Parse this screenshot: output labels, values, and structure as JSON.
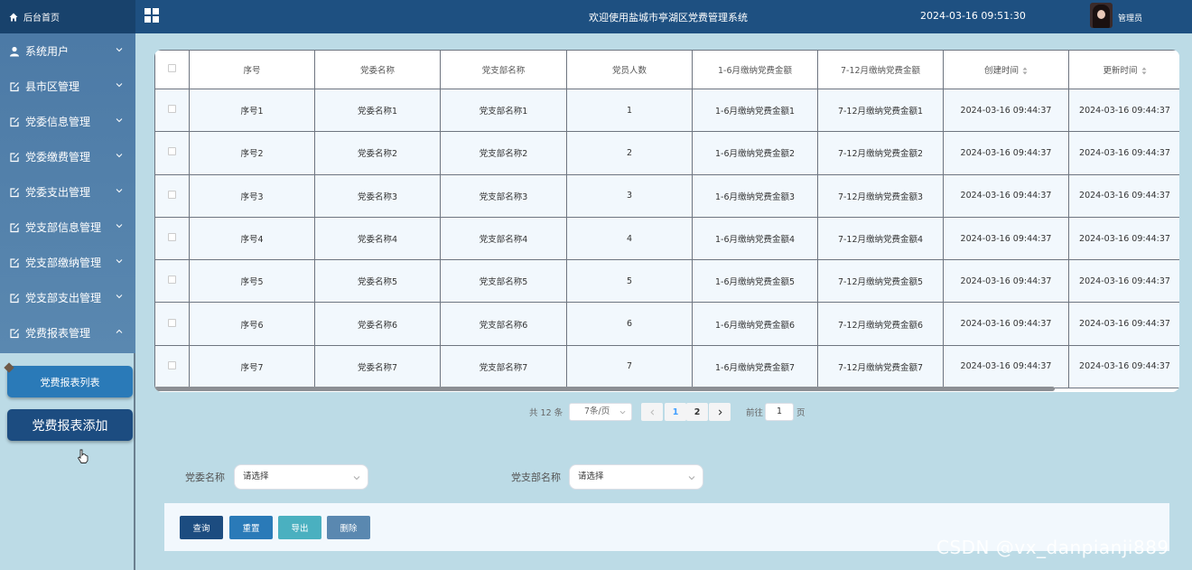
{
  "header": {
    "home_label": "后台首页",
    "welcome": "欢迎使用盐城市亭湖区党费管理系统",
    "datetime": "2024-03-16 09:51:30",
    "user_label": "管理员"
  },
  "sidebar": {
    "items": [
      {
        "label": "系统用户"
      },
      {
        "label": "县市区管理"
      },
      {
        "label": "党委信息管理"
      },
      {
        "label": "党委缴费管理"
      },
      {
        "label": "党委支出管理"
      },
      {
        "label": "党支部信息管理"
      },
      {
        "label": "党支部缴纳管理"
      },
      {
        "label": "党支部支出管理"
      },
      {
        "label": "党费报表管理"
      }
    ],
    "sub_items": [
      {
        "label": "党费报表列表"
      },
      {
        "label": "党费报表添加"
      }
    ]
  },
  "table": {
    "columns": [
      "序号",
      "党委名称",
      "党支部名称",
      "党员人数",
      "1-6月缴纳党费金额",
      "7-12月缴纳党费金额",
      "创建时间",
      "更新时间"
    ],
    "rows": [
      [
        "序号1",
        "党委名称1",
        "党支部名称1",
        "1",
        "1-6月缴纳党费金额1",
        "7-12月缴纳党费金额1",
        "2024-03-16 09:44:37",
        "2024-03-16 09:44:37"
      ],
      [
        "序号2",
        "党委名称2",
        "党支部名称2",
        "2",
        "1-6月缴纳党费金额2",
        "7-12月缴纳党费金额2",
        "2024-03-16 09:44:37",
        "2024-03-16 09:44:37"
      ],
      [
        "序号3",
        "党委名称3",
        "党支部名称3",
        "3",
        "1-6月缴纳党费金额3",
        "7-12月缴纳党费金额3",
        "2024-03-16 09:44:37",
        "2024-03-16 09:44:37"
      ],
      [
        "序号4",
        "党委名称4",
        "党支部名称4",
        "4",
        "1-6月缴纳党费金额4",
        "7-12月缴纳党费金额4",
        "2024-03-16 09:44:37",
        "2024-03-16 09:44:37"
      ],
      [
        "序号5",
        "党委名称5",
        "党支部名称5",
        "5",
        "1-6月缴纳党费金额5",
        "7-12月缴纳党费金额5",
        "2024-03-16 09:44:37",
        "2024-03-16 09:44:37"
      ],
      [
        "序号6",
        "党委名称6",
        "党支部名称6",
        "6",
        "1-6月缴纳党费金额6",
        "7-12月缴纳党费金额6",
        "2024-03-16 09:44:37",
        "2024-03-16 09:44:37"
      ],
      [
        "序号7",
        "党委名称7",
        "党支部名称7",
        "7",
        "1-6月缴纳党费金额7",
        "7-12月缴纳党费金额7",
        "2024-03-16 09:44:37",
        "2024-03-16 09:44:37"
      ]
    ]
  },
  "pagination": {
    "total": "共 12 条",
    "page_size": "7条/页",
    "pages": [
      "1",
      "2"
    ],
    "current_page": "1",
    "goto_label": "前往",
    "goto_value": "1",
    "page_suffix": "页"
  },
  "filters": {
    "party_committee_label": "党委名称",
    "party_committee_value": "请选择",
    "party_branch_label": "党支部名称",
    "party_branch_value": "请选择"
  },
  "actions": {
    "query": "查询",
    "reset": "重置",
    "export": "导出",
    "delete": "删除"
  },
  "watermark": "CSDN @vx_danpianji889",
  "colors": {
    "header_bg": "#1e5081",
    "menu_bg": "#4c7aa6",
    "page_bg": "#bcdbe6",
    "accent": "#2a7ab8"
  }
}
